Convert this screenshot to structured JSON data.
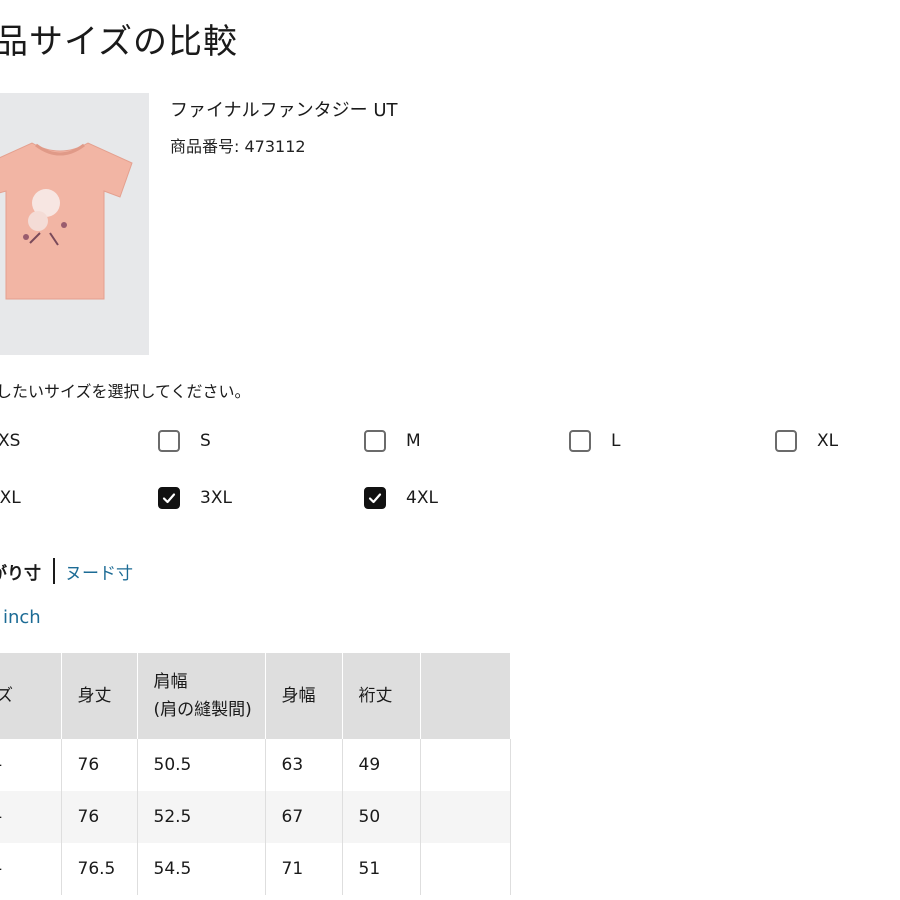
{
  "page": {
    "title": "品サイズの比較"
  },
  "product": {
    "name": "ファイナルファンタジー UT",
    "number": "商品番号: 473112",
    "image_icon": "tshirt-image",
    "shirt_color": "#f2b5a4"
  },
  "size_select": {
    "instruction": "したいサイズを選択してください。",
    "options": [
      {
        "label": "XS",
        "checked": false,
        "has_checkbox": false
      },
      {
        "label": "S",
        "checked": false,
        "has_checkbox": true
      },
      {
        "label": "M",
        "checked": false,
        "has_checkbox": true
      },
      {
        "label": "L",
        "checked": false,
        "has_checkbox": true
      },
      {
        "label": "XL",
        "checked": false,
        "has_checkbox": true
      },
      {
        "label": "XXL",
        "checked": false,
        "has_checkbox": false
      },
      {
        "label": "3XL",
        "checked": true,
        "has_checkbox": true
      },
      {
        "label": "4XL",
        "checked": true,
        "has_checkbox": true
      }
    ]
  },
  "measure_tabs": {
    "active": "がり寸",
    "other": "ヌード寸"
  },
  "unit_toggle": "inch",
  "table": {
    "headers": [
      "ズ",
      "身丈",
      "肩幅\n(肩の縫製間)",
      "身幅",
      "裄丈",
      ""
    ],
    "rows": [
      [
        "-",
        "76",
        "50.5",
        "63",
        "49",
        ""
      ],
      [
        "-",
        "76",
        "52.5",
        "67",
        "50",
        ""
      ],
      [
        "-",
        "76.5",
        "54.5",
        "71",
        "51",
        ""
      ]
    ]
  },
  "colors": {
    "link": "#1c6b95",
    "checked_box": "#111111",
    "header_bg": "#dedede"
  }
}
